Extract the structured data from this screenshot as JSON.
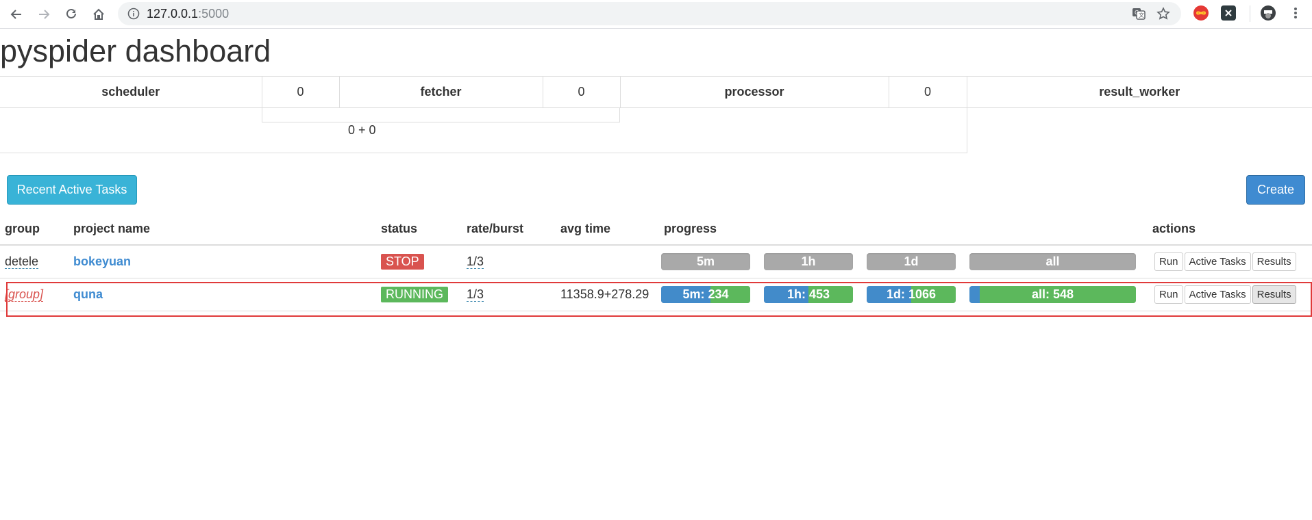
{
  "browser": {
    "url_host": "127.0.0.1",
    "url_port": ":5000",
    "icons": [
      "back-icon",
      "forward-icon",
      "reload-icon",
      "home-icon",
      "site-info-icon",
      "translate-icon",
      "bookmark-star-icon",
      "extension-infinity-icon",
      "extension-x-icon",
      "profile-avatar-icon",
      "menu-kebab-icon"
    ]
  },
  "page": {
    "title": "pyspider dashboard"
  },
  "counters": {
    "scheduler_label": "scheduler",
    "scheduler_value": "0",
    "fetcher_label": "fetcher",
    "fetcher_value": "0",
    "processor_label": "processor",
    "processor_value": "0",
    "result_worker_label": "result_worker",
    "queue_sum": "0 + 0"
  },
  "buttons": {
    "recent_active_tasks": "Recent Active Tasks",
    "create": "Create"
  },
  "table": {
    "headers": {
      "group": "group",
      "project_name": "project name",
      "status": "status",
      "rate_burst": "rate/burst",
      "avg_time": "avg time",
      "progress": "progress",
      "actions": "actions"
    },
    "rows": [
      {
        "group": "detele",
        "name": "bokeyuan",
        "status": "STOP",
        "rate": "1/3",
        "avg_time": "",
        "progress": {
          "m5": {
            "label": "5m",
            "fraction": 0
          },
          "h1": {
            "label": "1h",
            "fraction": 0
          },
          "d1": {
            "label": "1d",
            "fraction": 0
          },
          "all": {
            "label": "all",
            "fraction": 0
          }
        },
        "actions": {
          "run": "Run",
          "active": "Active Tasks",
          "results": "Results"
        }
      },
      {
        "group": "[group]",
        "name": "quna",
        "status": "RUNNING",
        "rate": "1/3",
        "avg_time": "11358.9+278.29",
        "progress": {
          "m5": {
            "label": "5m: 234",
            "pending_fraction": 0.55
          },
          "h1": {
            "label": "1h: 453",
            "pending_fraction": 0.5
          },
          "d1": {
            "label": "1d: 1066",
            "pending_fraction": 0.5
          },
          "all": {
            "label": "all: 548",
            "pending_fraction": 0.06
          }
        },
        "actions": {
          "run": "Run",
          "active": "Active Tasks",
          "results": "Results"
        }
      }
    ]
  },
  "colors": {
    "stop": "#d9534f",
    "running": "#5cb85c",
    "progress_pending": "#428bca",
    "progress_success": "#5cb85c",
    "progress_empty": "#a9a9a9",
    "link": "#3f8bd1",
    "highlight": "#e03a3a"
  }
}
